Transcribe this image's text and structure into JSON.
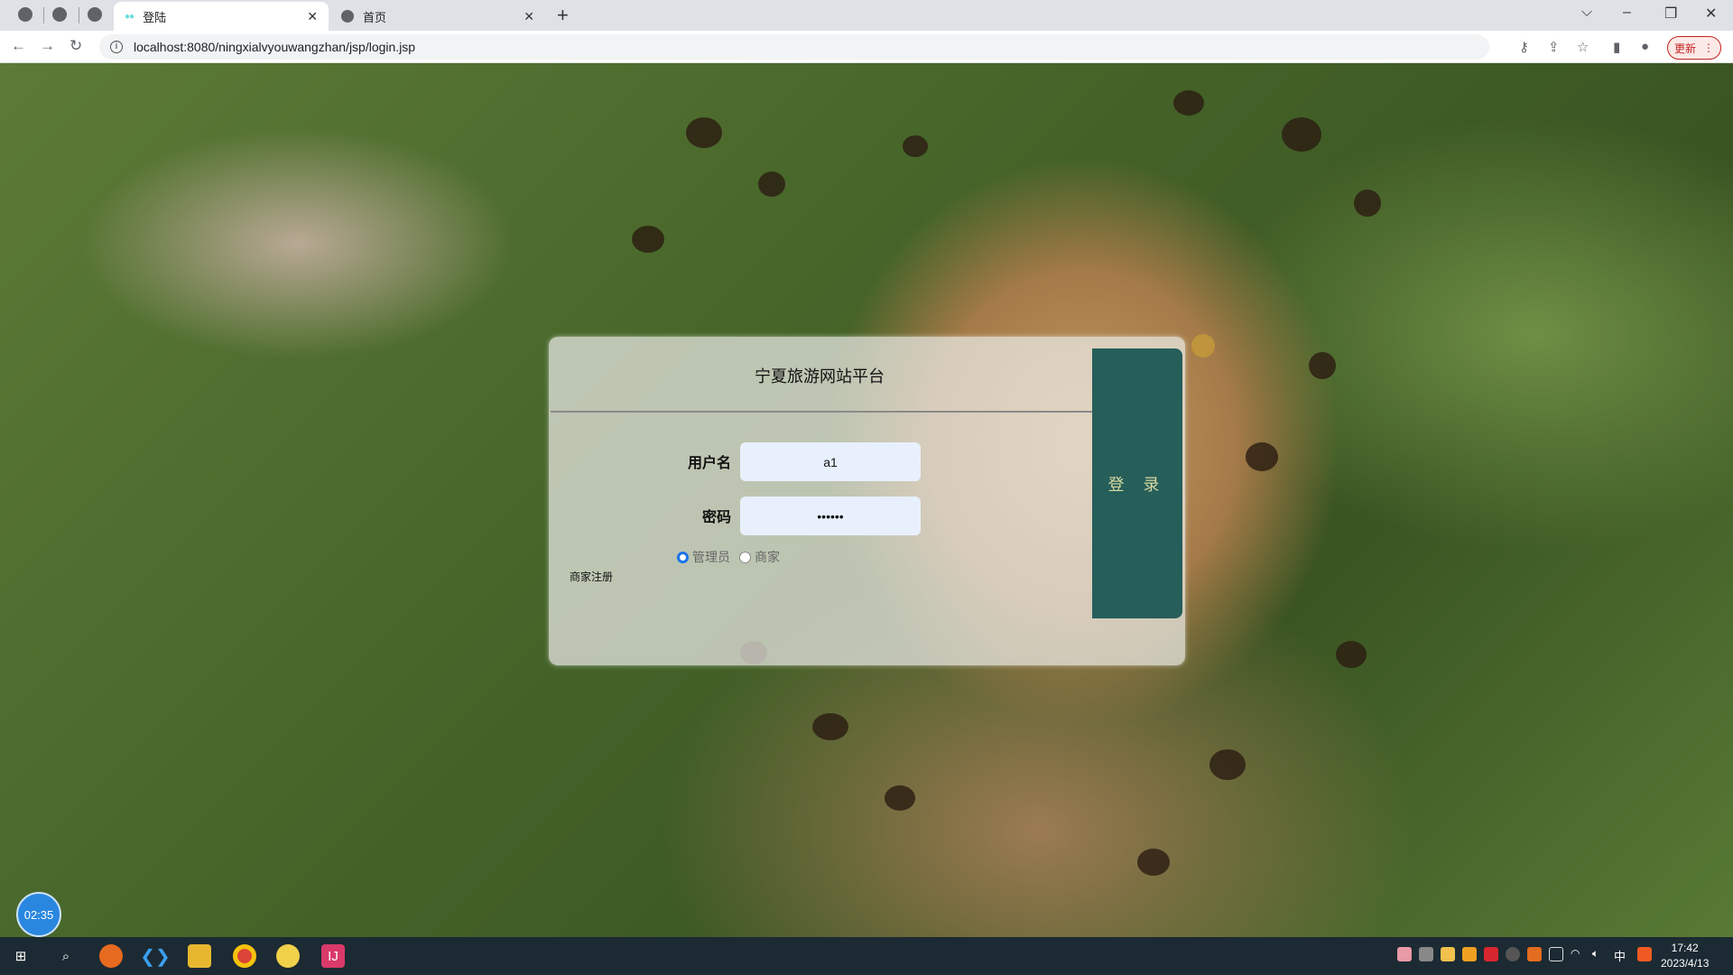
{
  "browser": {
    "tabs": [
      {
        "label": "登陆",
        "active": true
      },
      {
        "label": "首页",
        "active": false
      }
    ],
    "new_tab": "+",
    "url": "localhost:8080/ningxialvyouwangzhan/jsp/login.jsp",
    "update_label": "更新"
  },
  "login": {
    "title": "宁夏旅游网站平台",
    "username_label": "用户名",
    "username_value": "a1",
    "password_label": "密码",
    "password_value": "aaaaaa",
    "roles": [
      {
        "label": "管理员",
        "checked": true
      },
      {
        "label": "商家",
        "checked": false
      }
    ],
    "register_link": "商家注册",
    "login_button": "登 录"
  },
  "timer": "02:35",
  "taskbar": {
    "time": "17:42",
    "date": "2023/4/13",
    "ime": "中"
  },
  "colors": {
    "button": "#265e5a",
    "button_text": "#d8d8a0",
    "input_bg": "#e8f0fe"
  }
}
